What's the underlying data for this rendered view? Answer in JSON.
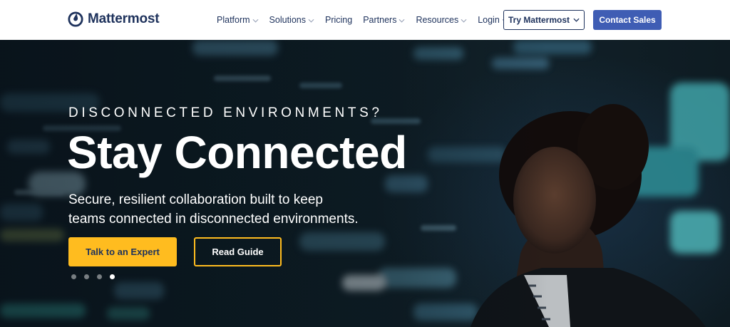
{
  "brand": {
    "name": "Mattermost",
    "logo_icon": "mattermost-logo-icon"
  },
  "nav": {
    "items": [
      {
        "label": "Platform",
        "has_dropdown": true
      },
      {
        "label": "Solutions",
        "has_dropdown": true
      },
      {
        "label": "Pricing",
        "has_dropdown": false
      },
      {
        "label": "Partners",
        "has_dropdown": true
      },
      {
        "label": "Resources",
        "has_dropdown": true
      },
      {
        "label": "Login",
        "has_dropdown": true
      }
    ],
    "try_button": "Try Mattermost",
    "contact_button": "Contact Sales"
  },
  "hero": {
    "eyebrow": "DISCONNECTED ENVIRONMENTS?",
    "headline": "Stay Connected",
    "subtext_line1": "Secure, resilient collaboration built to keep",
    "subtext_line2": "teams connected in disconnected environments.",
    "primary_cta": "Talk to an Expert",
    "secondary_cta": "Read Guide",
    "carousel": {
      "slides": 4,
      "active_index": 3
    }
  },
  "colors": {
    "navy": "#1e325c",
    "contact_blue": "#3f5db4",
    "accent_yellow": "#ffbc1f",
    "hero_dark": "#0f2029"
  }
}
